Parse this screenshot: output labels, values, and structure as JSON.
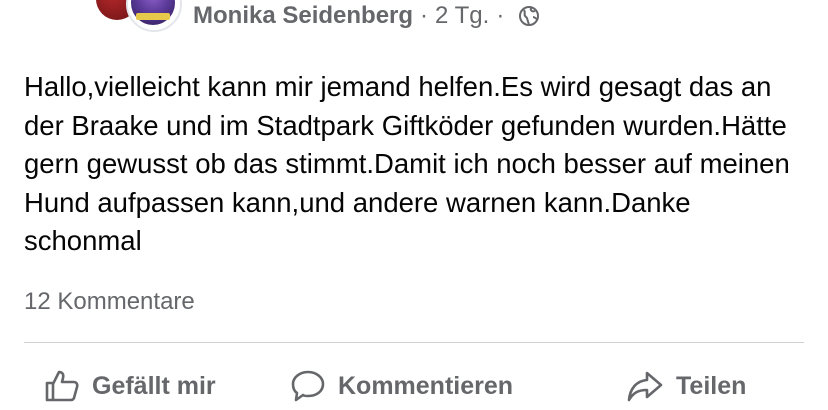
{
  "post": {
    "author": "Monika Seidenberg",
    "separator": "·",
    "timestamp": "2 Tg.",
    "audience_icon": "globe-icon",
    "text": "Hallo,vielleicht kann mir jemand helfen.Es wird gesagt das an der Braake und im Stadtpark Giftköder gefunden wurden.Hätte gern gewusst ob das stimmt.Damit ich noch besser auf meinen Hund aufpassen kann,und andere warnen kann.Danke schonmal",
    "comments_count": "12 Kommentare"
  },
  "actions": {
    "like_label": "Gefällt mir",
    "comment_label": "Kommentieren",
    "share_label": "Teilen"
  },
  "icons": {
    "like": "thumbs-up-icon",
    "comment": "speech-bubble-icon",
    "share": "share-arrow-icon"
  },
  "colors": {
    "text": "#050505",
    "secondary_text": "#65676b",
    "divider": "#ced0d4"
  }
}
